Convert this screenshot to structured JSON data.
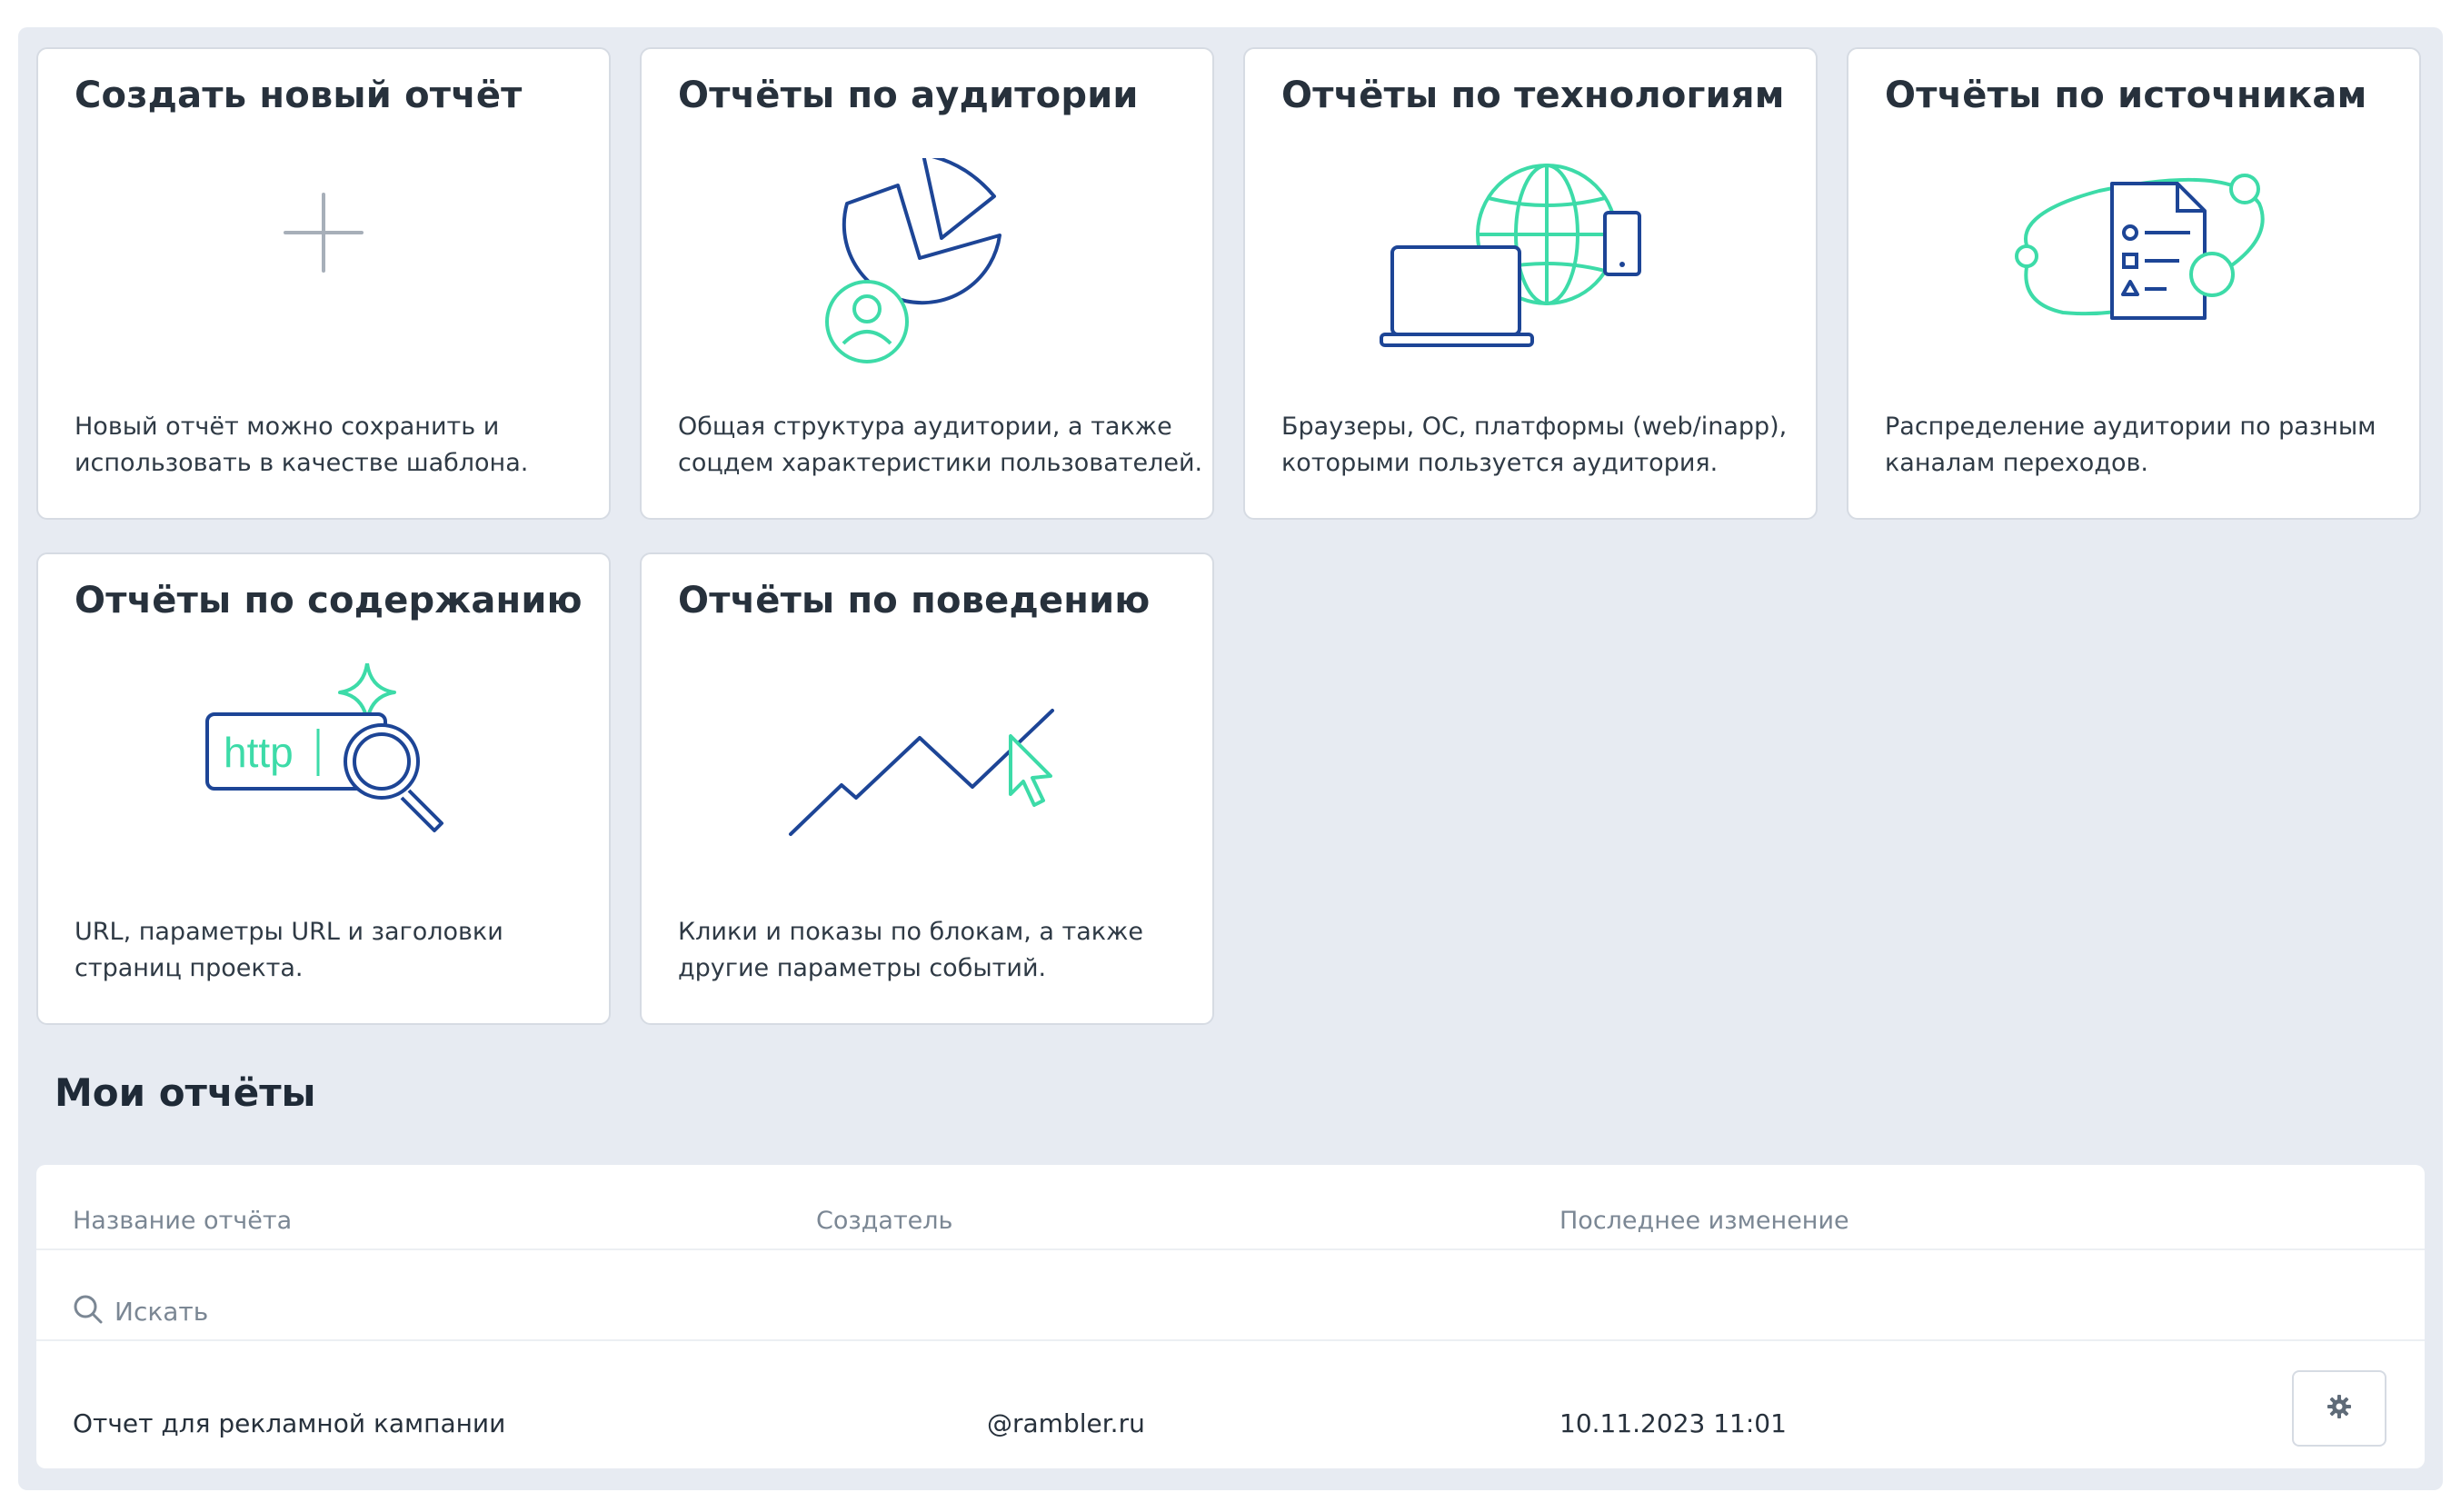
{
  "cards": [
    {
      "title": "Создать новый отчёт",
      "icon": "plus-icon",
      "desc_line1": "Новый отчёт можно сохранить и",
      "desc_line2": "использовать в качестве шаблона."
    },
    {
      "title": "Отчёты по аудитории",
      "icon": "audience-pie-chart-icon",
      "desc_line1": "Общая структура аудитории, а также",
      "desc_line2": "соцдем характеристики пользователей."
    },
    {
      "title": "Отчёты по технологиям",
      "icon": "devices-globe-icon",
      "desc_line1": "Браузеры, ОС, платформы (web/inapp),",
      "desc_line2": "которыми пользуется аудитория."
    },
    {
      "title": "Отчёты по источникам",
      "icon": "traffic-sources-icon",
      "desc_line1": "Распределение аудитории по разным",
      "desc_line2": "каналам переходов."
    },
    {
      "title": "Отчёты по содержанию",
      "icon": "url-search-icon",
      "icon_text": "http",
      "desc_line1": "URL, параметры URL и заголовки",
      "desc_line2": "страниц проекта."
    },
    {
      "title": "Отчёты по поведению",
      "icon": "behavior-trend-cursor-icon",
      "desc_line1": "Клики и показы по блокам, а также",
      "desc_line2": "другие параметры событий."
    }
  ],
  "my_reports": {
    "title": "Мои отчёты",
    "columns": {
      "name": "Название отчёта",
      "creator": "Создатель",
      "modified": "Последнее изменение"
    },
    "search_placeholder": "Искать",
    "rows": [
      {
        "name": "Отчет для рекламной кампании",
        "creator": "@rambler.ru",
        "modified": "10.11.2023 11:01",
        "action_icon": "gear-icon"
      }
    ]
  },
  "colors": {
    "background": "#e7ebf2",
    "card": "#ffffff",
    "icon_dark_blue": "#1d4596",
    "icon_mint": "#3ddba8",
    "icon_gray": "#a7afb9"
  }
}
